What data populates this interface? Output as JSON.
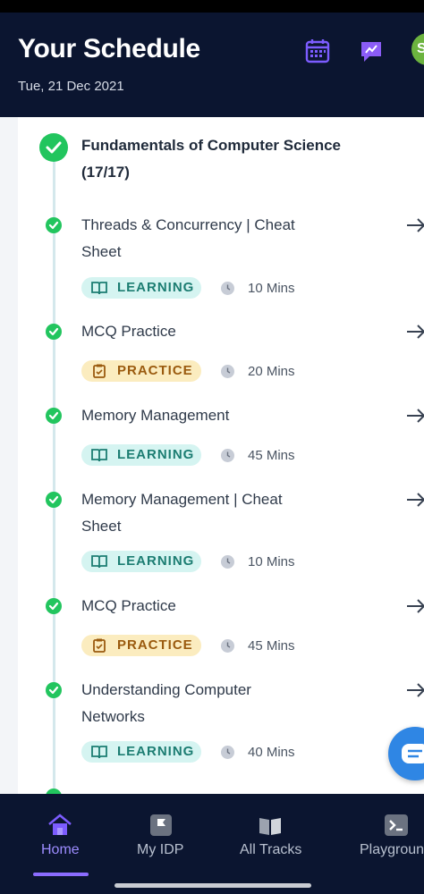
{
  "header": {
    "title": "Your Schedule",
    "date": "Tue, 21 Dec 2021",
    "avatar_initial": "S"
  },
  "section": {
    "title": "Fundamentals of Computer Science (17/17)"
  },
  "items": [
    {
      "title": "Threads & Concurrency | Cheat Sheet",
      "type": "LEARNING",
      "duration": "10 Mins"
    },
    {
      "title": "MCQ Practice",
      "type": "PRACTICE",
      "duration": "20 Mins"
    },
    {
      "title": "Memory Management",
      "type": "LEARNING",
      "duration": "45 Mins"
    },
    {
      "title": "Memory Management | Cheat Sheet",
      "type": "LEARNING",
      "duration": "10 Mins"
    },
    {
      "title": "MCQ Practice",
      "type": "PRACTICE",
      "duration": "45 Mins"
    },
    {
      "title": "Understanding Computer Networks",
      "type": "LEARNING",
      "duration": "40 Mins"
    }
  ],
  "nav": [
    {
      "label": "Home",
      "icon": "home-icon",
      "active": true
    },
    {
      "label": "My IDP",
      "icon": "flag-icon",
      "active": false
    },
    {
      "label": "All Tracks",
      "icon": "book-icon",
      "active": false
    },
    {
      "label": "Playground",
      "icon": "terminal-icon",
      "active": false
    }
  ],
  "colors": {
    "header_bg": "#0b1530",
    "check_green": "#22c55e",
    "learning_bg": "#d5f4f1",
    "practice_bg": "#fbecbf",
    "accent_purple": "#8b6cff"
  }
}
